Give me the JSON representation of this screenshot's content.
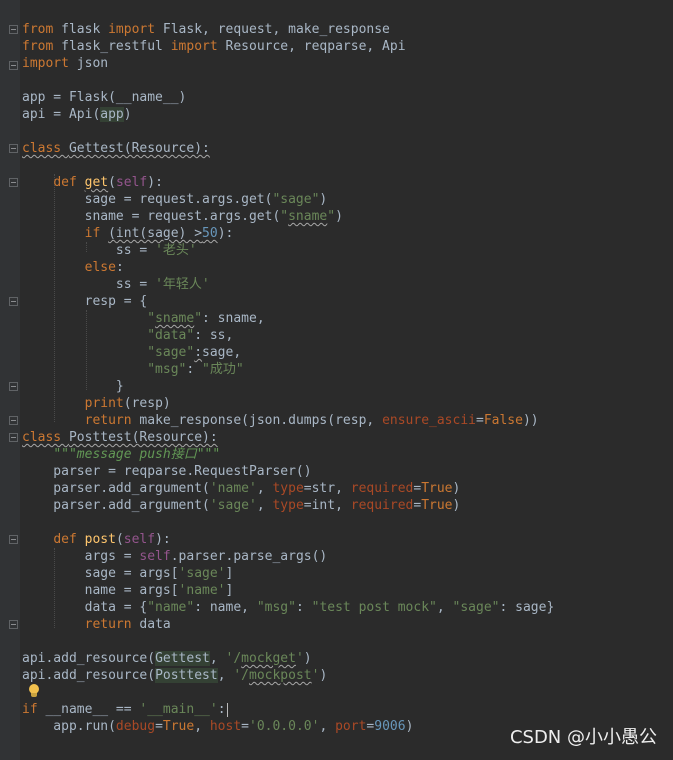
{
  "editor": {
    "lines": [
      [
        {
          "t": "from ",
          "c": "kw"
        },
        {
          "t": "flask "
        },
        {
          "t": "import ",
          "c": "kw"
        },
        {
          "t": "Flask, request, make_response"
        }
      ],
      [
        {
          "t": "from ",
          "c": "kw"
        },
        {
          "t": "flask_restful "
        },
        {
          "t": "import ",
          "c": "kw"
        },
        {
          "t": "Resource, reqparse, Api"
        }
      ],
      [
        {
          "t": "import ",
          "c": "kw"
        },
        {
          "t": "json"
        }
      ],
      [],
      [
        {
          "t": "app = Flask(__name__)"
        }
      ],
      [
        {
          "t": "api = Api("
        },
        {
          "t": "app",
          "c": "hl"
        },
        {
          "t": ")"
        }
      ],
      [],
      [
        {
          "t": "class ",
          "c": "kw ul"
        },
        {
          "t": "Gettest(Resource):",
          "c": "ul"
        }
      ],
      [],
      [
        {
          "t": "    "
        },
        {
          "t": "def ",
          "c": "kw"
        },
        {
          "t": "get",
          "c": "def ul"
        },
        {
          "t": "("
        },
        {
          "t": "self",
          "c": "self"
        },
        {
          "t": "):"
        }
      ],
      [
        {
          "t": "        sage = request.args.get("
        },
        {
          "t": "\"sage\"",
          "c": "str"
        },
        {
          "t": ")"
        }
      ],
      [
        {
          "t": "        sname = request.args.get("
        },
        {
          "t": "\"",
          "c": "str"
        },
        {
          "t": "sname",
          "c": "str ul"
        },
        {
          "t": "\"",
          "c": "str"
        },
        {
          "t": ")"
        }
      ],
      [
        {
          "t": "        "
        },
        {
          "t": "if ",
          "c": "kw"
        },
        {
          "t": "(int(sage) >",
          "c": "ul"
        },
        {
          "t": "50",
          "c": "num ul"
        },
        {
          "t": "):"
        }
      ],
      [
        {
          "t": "            ss = "
        },
        {
          "t": "'老头'",
          "c": "str"
        }
      ],
      [
        {
          "t": "        "
        },
        {
          "t": "else",
          "c": "kw"
        },
        {
          "t": ":"
        }
      ],
      [
        {
          "t": "            ss = "
        },
        {
          "t": "'年轻人'",
          "c": "str"
        }
      ],
      [
        {
          "t": "        resp = {"
        }
      ],
      [
        {
          "t": "                "
        },
        {
          "t": "\"",
          "c": "str"
        },
        {
          "t": "sname",
          "c": "str ul"
        },
        {
          "t": "\"",
          "c": "str"
        },
        {
          "t": ": sname,"
        }
      ],
      [
        {
          "t": "                "
        },
        {
          "t": "\"data\"",
          "c": "str"
        },
        {
          "t": ": ss,"
        }
      ],
      [
        {
          "t": "                "
        },
        {
          "t": "\"sage\"",
          "c": "str"
        },
        {
          "t": ":",
          "c": "ul"
        },
        {
          "t": "sage,"
        }
      ],
      [
        {
          "t": "                "
        },
        {
          "t": "\"msg\"",
          "c": "str"
        },
        {
          "t": ": "
        },
        {
          "t": "\"成功\"",
          "c": "str"
        }
      ],
      [
        {
          "t": "            }"
        }
      ],
      [
        {
          "t": "        "
        },
        {
          "t": "print",
          "c": "kw"
        },
        {
          "t": "(resp)"
        }
      ],
      [
        {
          "t": "        "
        },
        {
          "t": "return ",
          "c": "kw"
        },
        {
          "t": "make_response(json.dumps(resp, "
        },
        {
          "t": "ensure_ascii",
          "c": "param"
        },
        {
          "t": "="
        },
        {
          "t": "False",
          "c": "kw"
        },
        {
          "t": "))"
        }
      ],
      [
        {
          "t": "class ",
          "c": "kw ul"
        },
        {
          "t": "Posttest(Resource):",
          "c": "ul"
        }
      ],
      [
        {
          "t": "    "
        },
        {
          "t": "\"\"\"message push接口\"\"\"",
          "c": "doc"
        }
      ],
      [
        {
          "t": "    parser = reqparse.RequestParser()"
        }
      ],
      [
        {
          "t": "    parser.add_argument("
        },
        {
          "t": "'name'",
          "c": "str"
        },
        {
          "t": ", "
        },
        {
          "t": "type",
          "c": "param"
        },
        {
          "t": "=str, "
        },
        {
          "t": "required",
          "c": "param"
        },
        {
          "t": "="
        },
        {
          "t": "True",
          "c": "kw"
        },
        {
          "t": ")"
        }
      ],
      [
        {
          "t": "    parser.add_argument("
        },
        {
          "t": "'sage'",
          "c": "str"
        },
        {
          "t": ", "
        },
        {
          "t": "type",
          "c": "param"
        },
        {
          "t": "=int, "
        },
        {
          "t": "required",
          "c": "param"
        },
        {
          "t": "="
        },
        {
          "t": "True",
          "c": "kw"
        },
        {
          "t": ")"
        }
      ],
      [],
      [
        {
          "t": "    "
        },
        {
          "t": "def ",
          "c": "kw"
        },
        {
          "t": "post",
          "c": "def"
        },
        {
          "t": "("
        },
        {
          "t": "self",
          "c": "self"
        },
        {
          "t": "):"
        }
      ],
      [
        {
          "t": "        args = "
        },
        {
          "t": "self",
          "c": "self"
        },
        {
          "t": ".parser.parse_args()"
        }
      ],
      [
        {
          "t": "        sage = args["
        },
        {
          "t": "'sage'",
          "c": "str"
        },
        {
          "t": "]"
        }
      ],
      [
        {
          "t": "        name = args["
        },
        {
          "t": "'name'",
          "c": "str"
        },
        {
          "t": "]"
        }
      ],
      [
        {
          "t": "        data = {"
        },
        {
          "t": "\"name\"",
          "c": "str"
        },
        {
          "t": ": name, "
        },
        {
          "t": "\"msg\"",
          "c": "str"
        },
        {
          "t": ": "
        },
        {
          "t": "\"test post mock\"",
          "c": "str"
        },
        {
          "t": ", "
        },
        {
          "t": "\"sage\"",
          "c": "str"
        },
        {
          "t": ": sage}"
        }
      ],
      [
        {
          "t": "        "
        },
        {
          "t": "return ",
          "c": "kw"
        },
        {
          "t": "data"
        }
      ],
      [],
      [
        {
          "t": "api.add_resource("
        },
        {
          "t": "Gettest",
          "c": "hl"
        },
        {
          "t": ", "
        },
        {
          "t": "'/",
          "c": "str"
        },
        {
          "t": "mockget",
          "c": "str ul"
        },
        {
          "t": "'",
          "c": "str"
        },
        {
          "t": ")"
        }
      ],
      [
        {
          "t": "api.add_resource("
        },
        {
          "t": "Posttest",
          "c": "hl"
        },
        {
          "t": ", "
        },
        {
          "t": "'/",
          "c": "str"
        },
        {
          "t": "mockpost",
          "c": "str ul"
        },
        {
          "t": "'",
          "c": "str"
        },
        {
          "t": ")"
        }
      ],
      [],
      [
        {
          "t": "if ",
          "c": "kw"
        },
        {
          "t": "__name__ == "
        },
        {
          "t": "'__main__'",
          "c": "str"
        },
        {
          "t": ":"
        },
        {
          "caret": true
        }
      ],
      [
        {
          "t": "    app.run("
        },
        {
          "t": "debug",
          "c": "param"
        },
        {
          "t": "="
        },
        {
          "t": "True",
          "c": "kw"
        },
        {
          "t": ", "
        },
        {
          "t": "host",
          "c": "param"
        },
        {
          "t": "="
        },
        {
          "t": "'0.0.0.0'",
          "c": "str"
        },
        {
          "t": ", "
        },
        {
          "t": "port",
          "c": "param"
        },
        {
          "t": "="
        },
        {
          "t": "9006",
          "c": "num"
        },
        {
          "t": ")"
        }
      ]
    ]
  },
  "watermark": "CSDN @小小愚公",
  "icons": {
    "intention": "lightbulb-icon"
  }
}
